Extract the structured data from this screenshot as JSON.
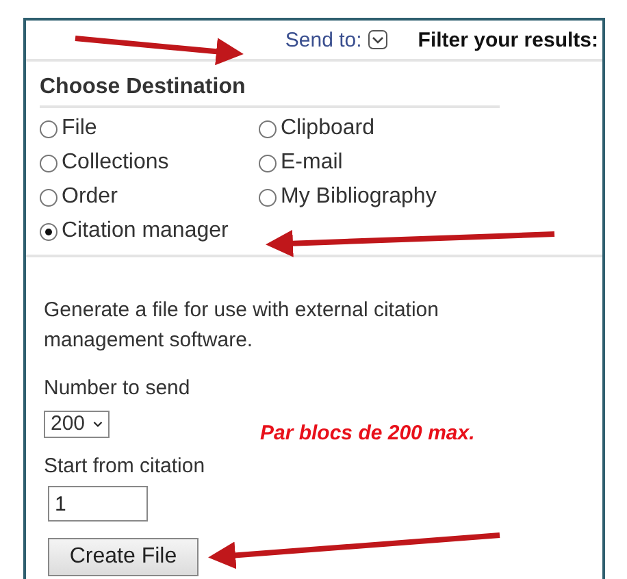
{
  "header": {
    "send_to": "Send to:",
    "filter": "Filter your results:"
  },
  "destination": {
    "title": "Choose Destination",
    "options": [
      {
        "label": "File",
        "selected": false
      },
      {
        "label": "Clipboard",
        "selected": false
      },
      {
        "label": "Collections",
        "selected": false
      },
      {
        "label": "E-mail",
        "selected": false
      },
      {
        "label": "Order",
        "selected": false
      },
      {
        "label": "My Bibliography",
        "selected": false
      },
      {
        "label": "Citation manager",
        "selected": true
      }
    ]
  },
  "form": {
    "description": "Generate a file for use with external citation management software.",
    "number_label": "Number to send",
    "number_value": "200",
    "note": "Par blocs de 200 max.",
    "start_label": "Start from citation",
    "start_value": "1",
    "button": "Create File"
  }
}
